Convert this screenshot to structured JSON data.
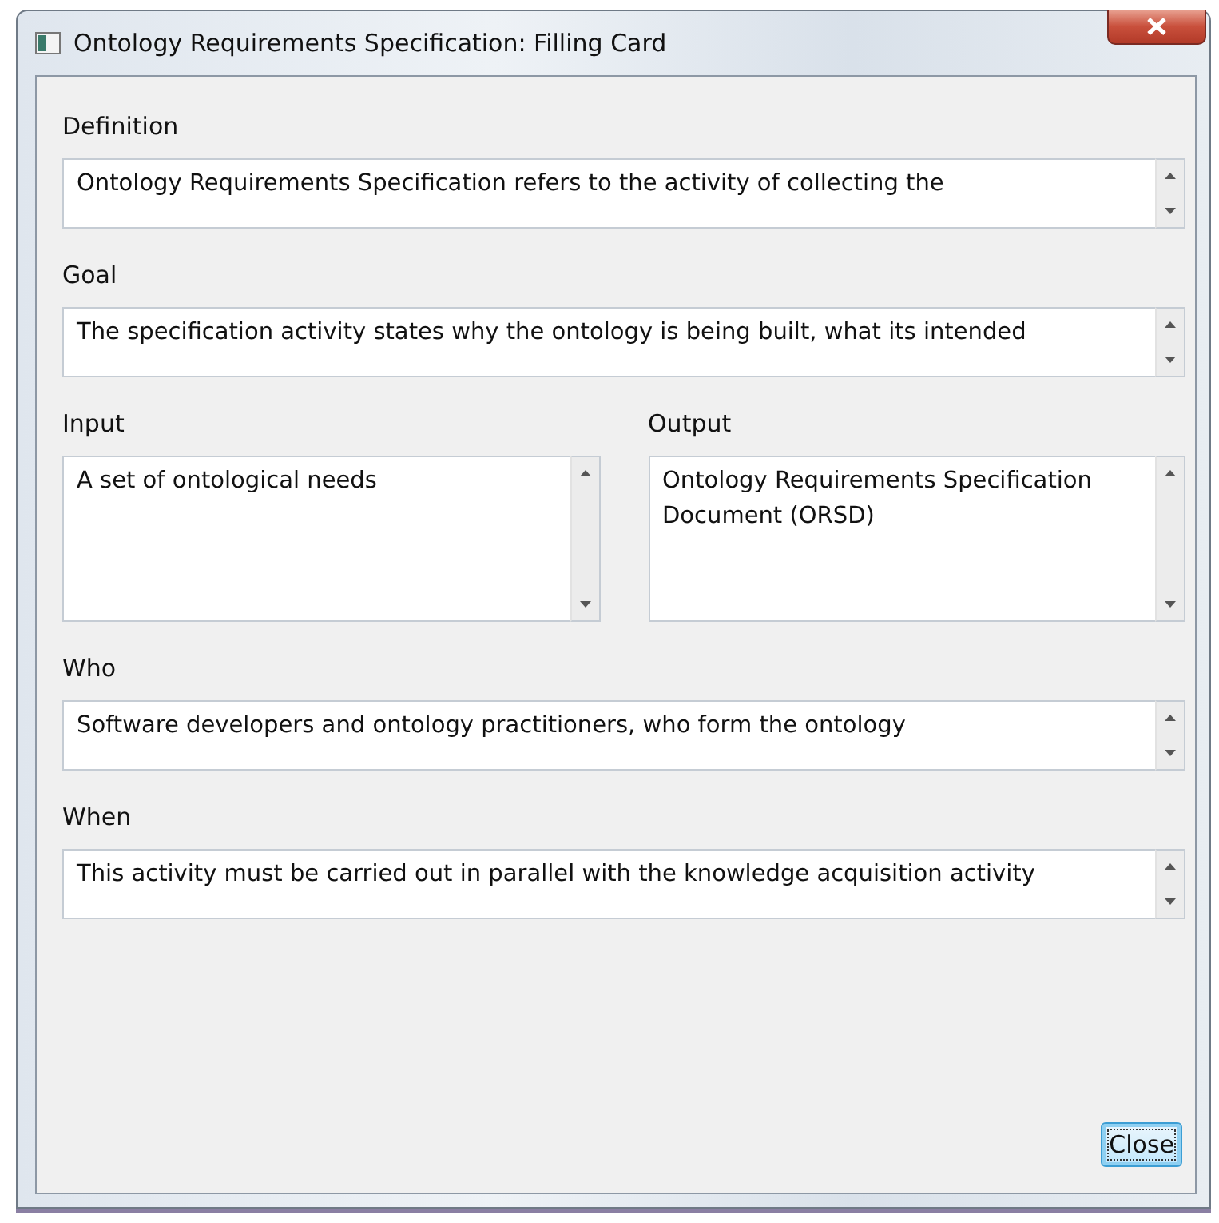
{
  "window": {
    "title": "Ontology Requirements Specification: Filling Card"
  },
  "rows": [
    {
      "fields": [
        {
          "label": "Definition",
          "value": "Ontology Requirements Specification refers to the activity of collecting the",
          "tall": false
        }
      ]
    },
    {
      "fields": [
        {
          "label": "Goal",
          "value": "The specification activity states why the ontology is being built, what its intended",
          "tall": false
        }
      ]
    },
    {
      "fields": [
        {
          "label": "Input",
          "value": "A set of ontological needs",
          "tall": true
        },
        {
          "label": "Output",
          "value": "Ontology Requirements Specification Document (ORSD)",
          "tall": true
        }
      ]
    },
    {
      "fields": [
        {
          "label": "Who",
          "value": "Software developers and ontology practitioners, who form the ontology",
          "tall": false
        }
      ]
    },
    {
      "fields": [
        {
          "label": "When",
          "value": "This activity must be carried out in parallel with the knowledge acquisition activity",
          "tall": false
        }
      ]
    }
  ],
  "buttons": [
    {
      "label": "Close",
      "focused": true
    }
  ]
}
